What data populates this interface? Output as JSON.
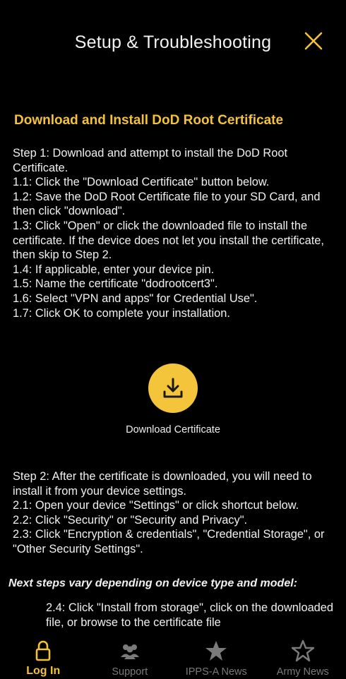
{
  "header": {
    "title": "Setup & Troubleshooting",
    "close_icon": "close-icon"
  },
  "section": {
    "title": "Download and Install DoD Root Certificate"
  },
  "step1": [
    "Step 1: Download and attempt to install the DoD Root Certificate.",
    "1.1: Click the \"Download Certificate\" button below.",
    "1.2: Save the DoD Root Certificate file to your SD Card, and then click \"download\".",
    "1.3: Click \"Open\" or click the downloaded file to install the certificate. If the device does not let you install the certificate, then skip to Step 2.",
    "1.4: If applicable, enter your device pin.",
    "1.5: Name the certificate \"dodrootcert3\".",
    "1.6: Select \"VPN and apps\" for Credential Use\".",
    "1.7: Click OK to complete your installation."
  ],
  "download": {
    "label": "Download Certificate",
    "icon": "download-icon"
  },
  "step2": [
    "Step 2: After the certificate is downloaded, you will need to install it from your device settings.",
    "2.1: Open your device \"Settings\" or click shortcut below.",
    "2.2: Click \"Security\" or \"Security and Privacy\".",
    "2.3: Click \"Encryption & credentials\", \"Credential Storage\", or \"Other Security Settings\"."
  ],
  "next_steps": "Next steps vary depending on device type and model:",
  "step24": "2.4: Click \"Install from storage\", click on the downloaded file, or browse to the certificate file",
  "tabs": [
    {
      "label": "Log In",
      "icon": "lock-icon",
      "active": true
    },
    {
      "label": "Support",
      "icon": "people-icon",
      "active": false
    },
    {
      "label": "IPPS-A News",
      "icon": "star-icon",
      "active": false
    },
    {
      "label": "Army News",
      "icon": "star-outline-icon",
      "active": false
    }
  ],
  "colors": {
    "accent": "#f3c23a",
    "background": "#000000",
    "inactive_tab": "#7a7a7a"
  }
}
